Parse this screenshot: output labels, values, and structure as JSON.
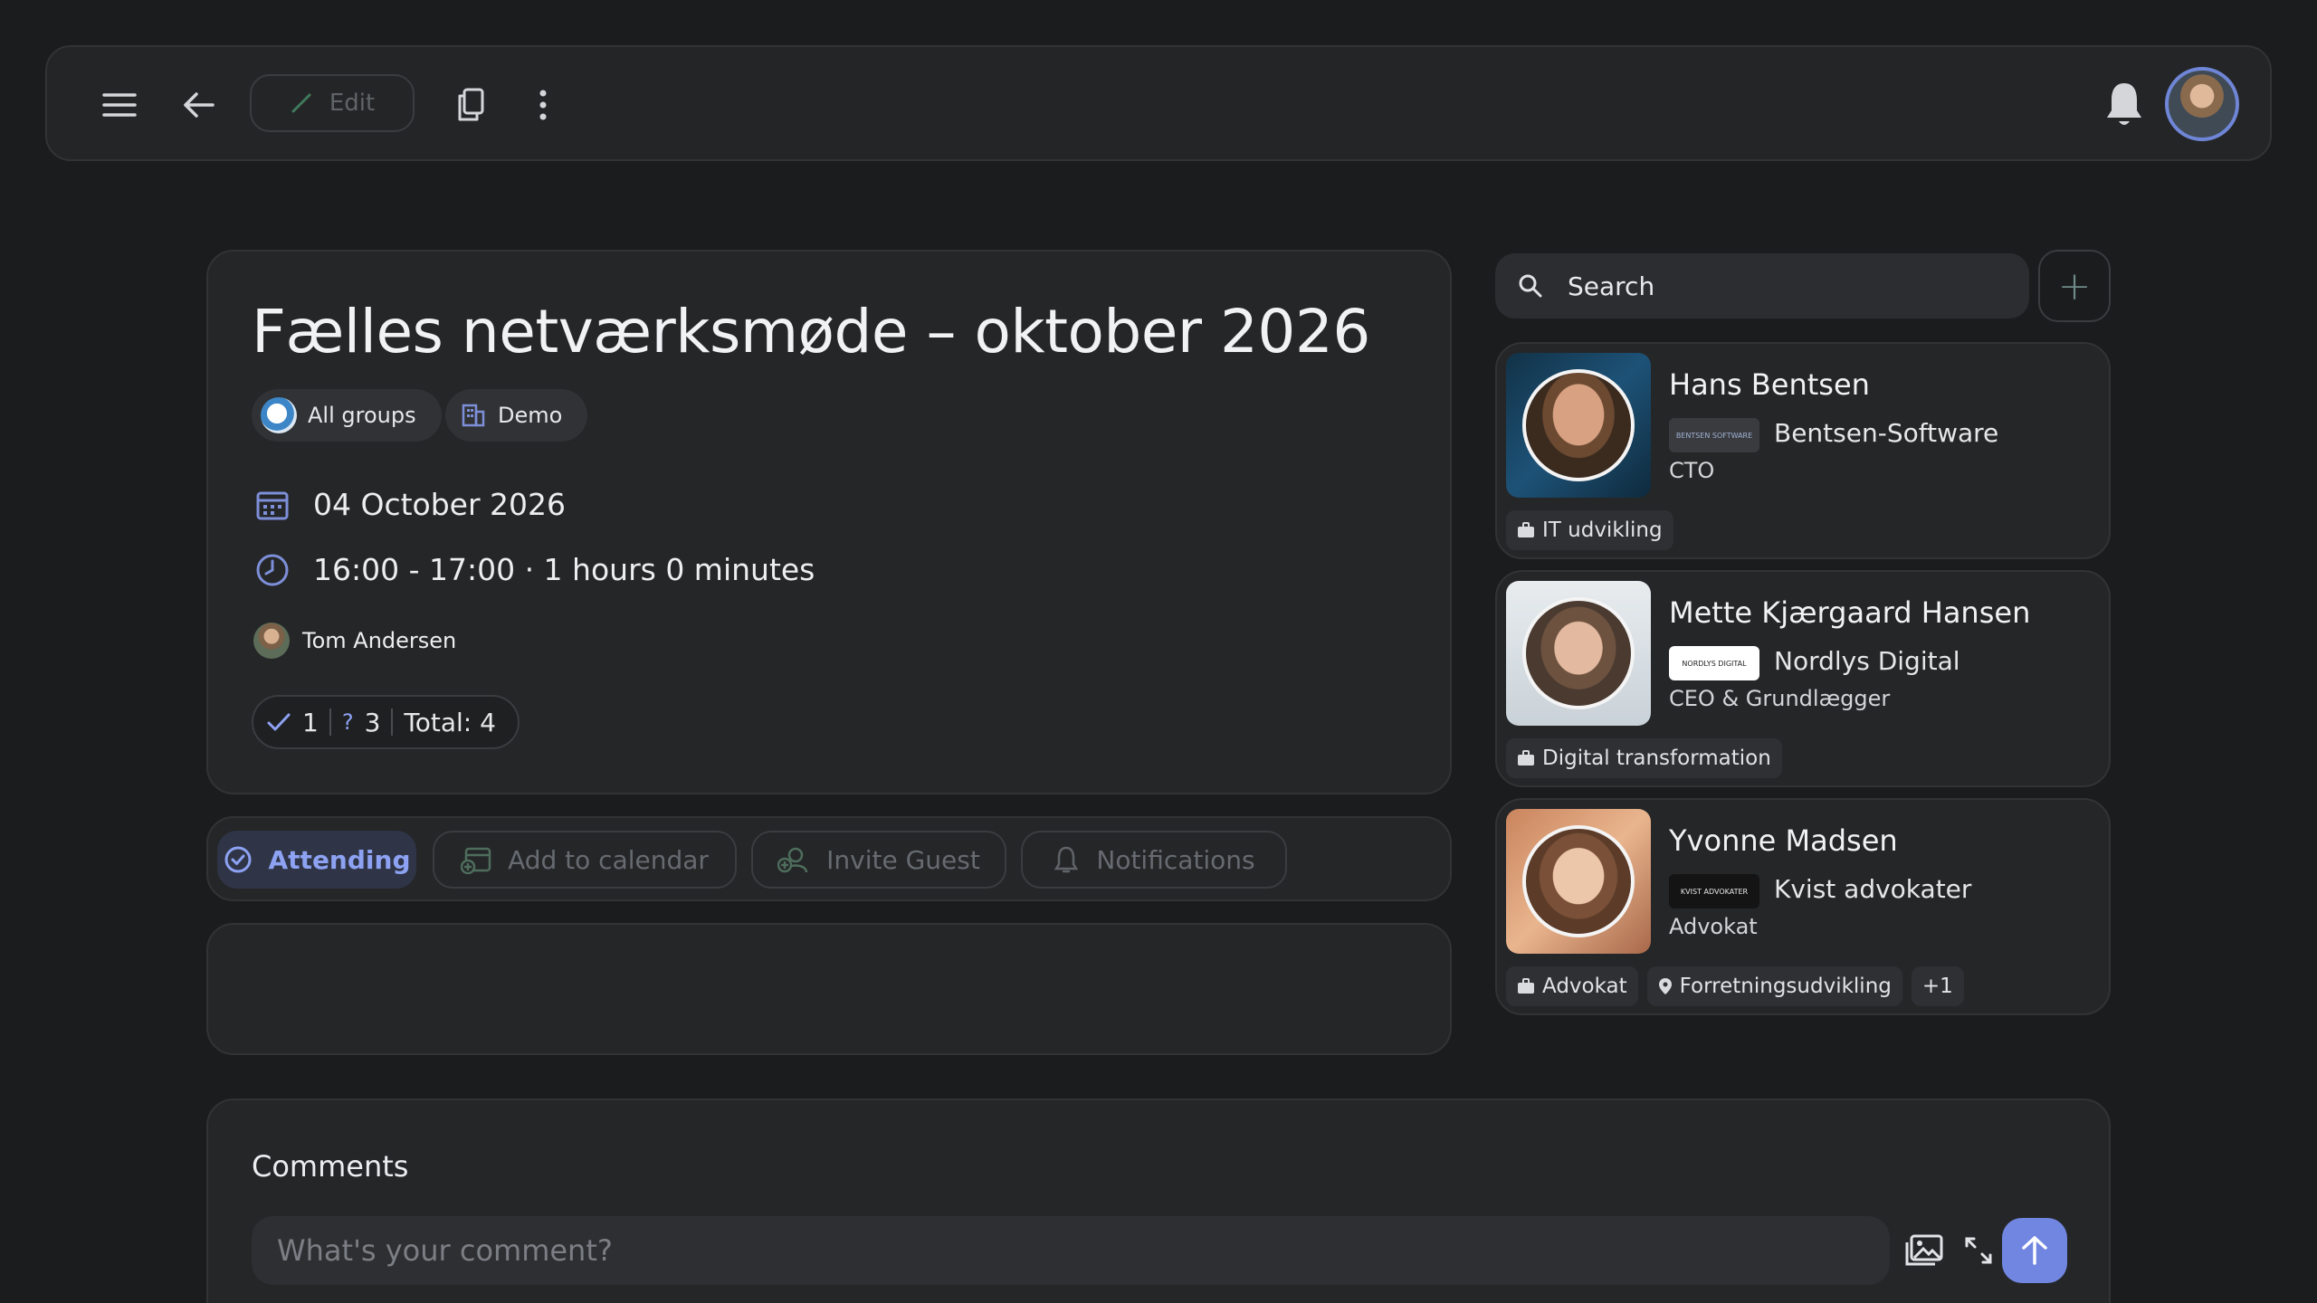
{
  "toolbar": {
    "edit_label": "Edit"
  },
  "event": {
    "title": "Fælles netværksmøde – oktober 2026",
    "chips": [
      {
        "label": "All groups",
        "icon": "globe-icon"
      },
      {
        "label": "Demo",
        "icon": "building-icon"
      }
    ],
    "date": "04 October 2026",
    "time": "16:00 - 17:00 · 1 hours 0 minutes",
    "organizer": "Tom Andersen",
    "counts": {
      "attending": "1",
      "maybe_symbol": "?",
      "maybe": "3",
      "total": "Total: 4"
    }
  },
  "actions": {
    "attending": "Attending",
    "add_to_calendar": "Add to calendar",
    "invite_guest": "Invite Guest",
    "notifications": "Notifications"
  },
  "people_search": {
    "placeholder": "Search",
    "add_symbol": "+"
  },
  "people": [
    {
      "name": "Hans Bentsen",
      "logo_text": "BENTSEN SOFTWARE",
      "company": "Bentsen-Software",
      "role": "CTO",
      "tags": [
        {
          "label": "IT udvikling",
          "icon": "briefcase-icon"
        }
      ]
    },
    {
      "name": "Mette Kjærgaard Hansen",
      "logo_text": "NORDLYS DIGITAL",
      "company": "Nordlys Digital",
      "role": "CEO & Grundlægger",
      "tags": [
        {
          "label": "Digital transformation",
          "icon": "briefcase-icon"
        }
      ]
    },
    {
      "name": "Yvonne Madsen",
      "logo_text": "KVIST ADVOKATER",
      "company": "Kvist advokater",
      "role": "Advokat",
      "tags": [
        {
          "label": "Advokat",
          "icon": "briefcase-icon"
        },
        {
          "label": "Forretningsudvikling",
          "icon": "pin-icon"
        },
        {
          "label": "+1",
          "icon": ""
        }
      ]
    }
  ],
  "comments": {
    "title": "Comments",
    "placeholder": "What's your comment?"
  },
  "colors": {
    "accent": "#7086e0",
    "accent_text": "#8da2f2",
    "notification_dot": "#e2453f",
    "background": "#1b1c1e",
    "card": "#252628"
  }
}
